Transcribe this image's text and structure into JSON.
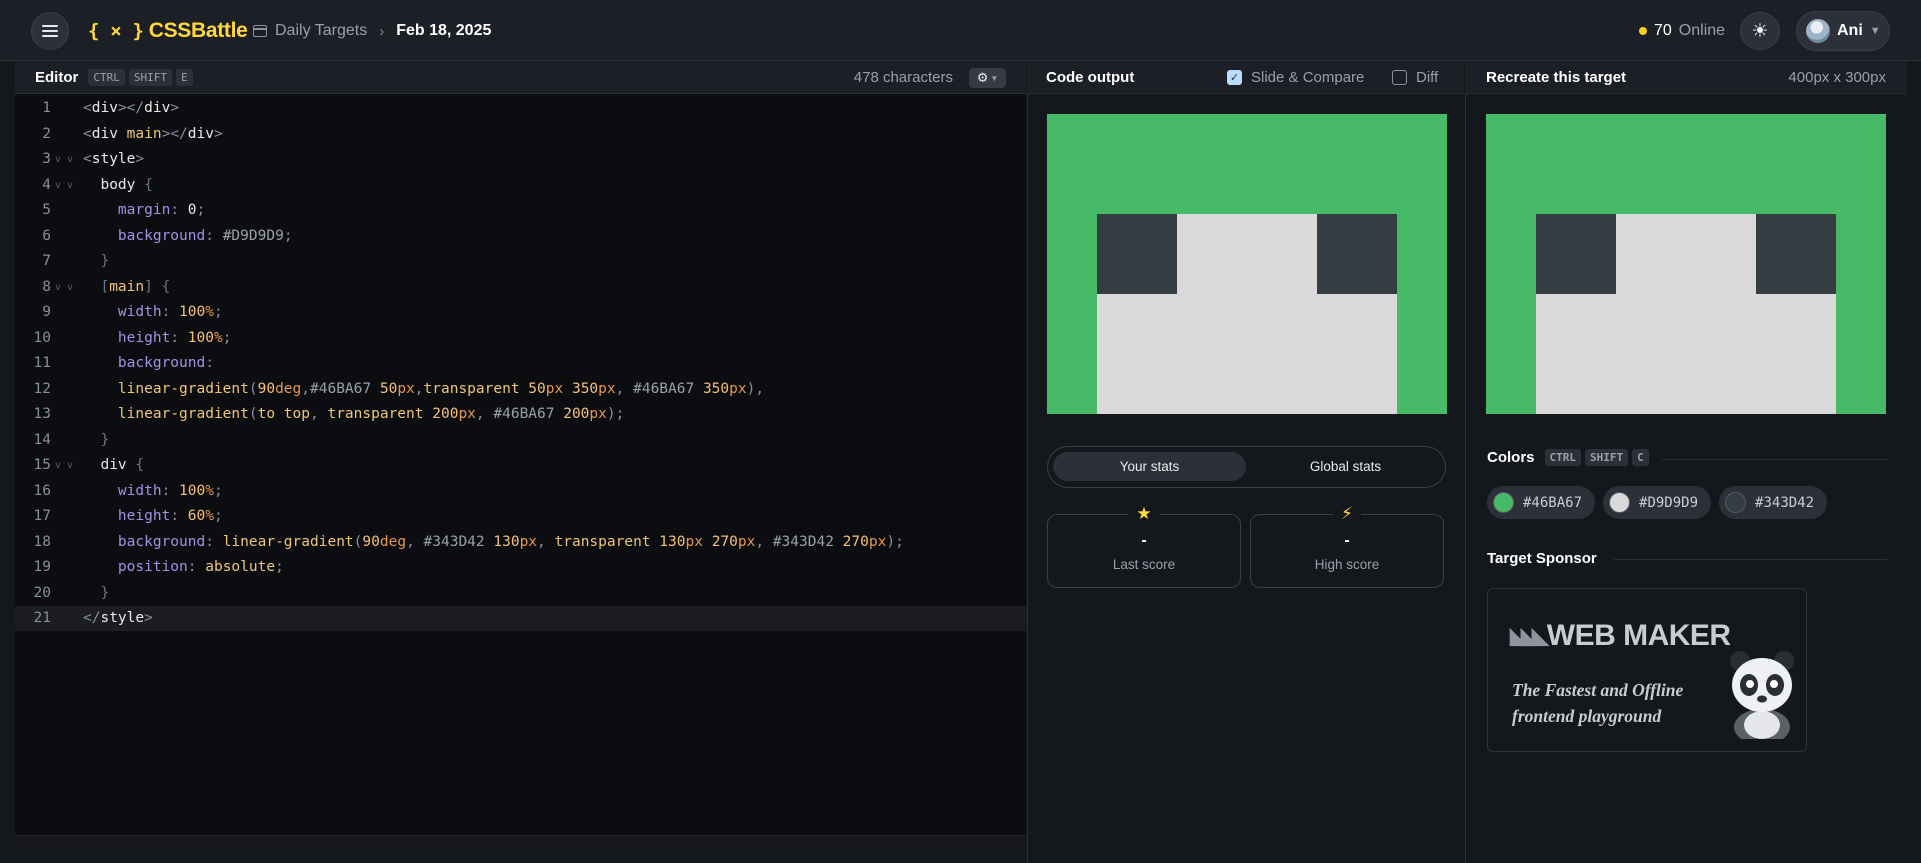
{
  "app": {
    "logo_text": "CSSBattle",
    "logo_mark": "{ × }"
  },
  "breadcrumb": {
    "section": "Daily Targets",
    "current": "Feb 18, 2025"
  },
  "header": {
    "online_count": "70",
    "online_label": "Online",
    "user_name": "Ani"
  },
  "editor": {
    "title": "Editor",
    "shortcut": [
      "CTRL",
      "SHIFT",
      "E"
    ],
    "char_count": "478 characters"
  },
  "output": {
    "title": "Code output",
    "slide_compare_label": "Slide & Compare",
    "slide_compare_checked": true,
    "diff_label": "Diff",
    "diff_checked": false,
    "stats_tabs": [
      "Your stats",
      "Global stats"
    ],
    "active_stats_tab": "Your stats",
    "last_score": {
      "value": "-",
      "label": "Last score"
    },
    "high_score": {
      "value": "-",
      "label": "High score"
    }
  },
  "target": {
    "title": "Recreate this target",
    "size": "400px x 300px",
    "colors_title": "Colors",
    "colors_shortcut": [
      "CTRL",
      "SHIFT",
      "C"
    ],
    "colors": [
      {
        "hex": "#46BA67"
      },
      {
        "hex": "#D9D9D9"
      },
      {
        "hex": "#343D42"
      }
    ],
    "sponsor_title": "Target Sponsor",
    "sponsor_logo": "WEB MAKER",
    "sponsor_tagline_1": "The Fastest and Offline",
    "sponsor_tagline_2": "frontend playground"
  },
  "icons": {
    "menu": "menu-icon",
    "theme": "sun-icon",
    "settings": "gear-icon",
    "calendar": "calendar-icon",
    "star": "star-icon",
    "bolt": "bolt-icon"
  },
  "code_lines": [
    "<div></div>",
    "<div main></div>",
    "<style>",
    "  body {",
    "    margin: 0;",
    "    background: #D9D9D9;",
    "  }",
    "  [main] {",
    "    width: 100%;",
    "    height: 100%;",
    "    background:",
    "    linear-gradient(90deg,#46BA67 50px,transparent 50px 350px, #46BA67 350px),",
    "    linear-gradient(to top, transparent 200px, #46BA67 200px);",
    "  }",
    "  div {",
    "    width: 100%;",
    "    height: 60%;",
    "    background: linear-gradient(90deg, #343D42 130px, transparent 130px 270px, #343D42 270px);",
    "    position: absolute;",
    "  }",
    "</style>"
  ],
  "active_line": 21,
  "fold_lines": [
    3,
    4,
    8,
    15
  ]
}
